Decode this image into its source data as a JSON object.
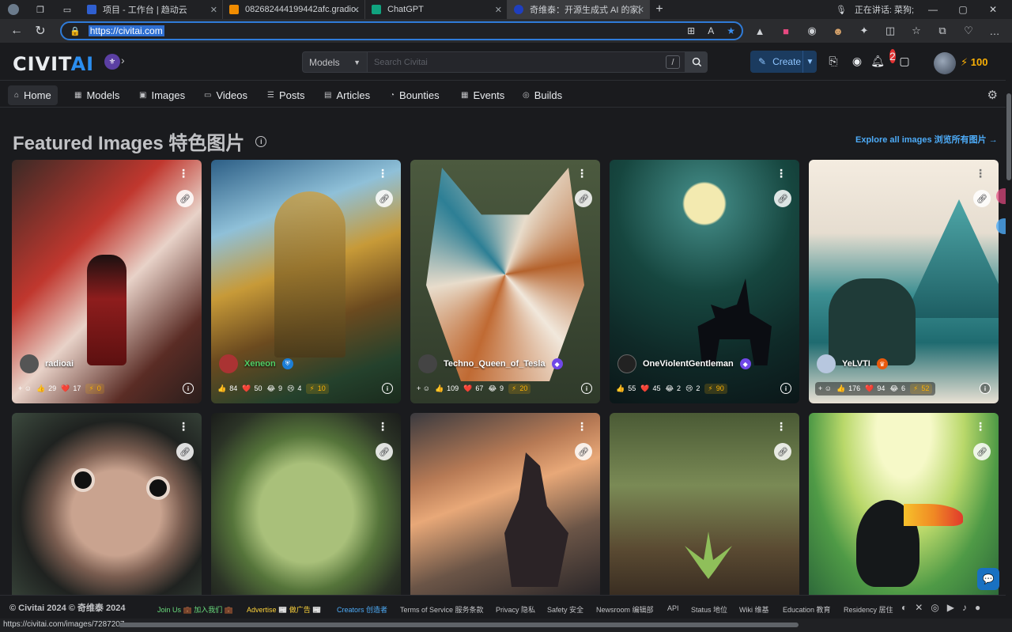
{
  "browser": {
    "tabs": [
      {
        "title": "项目 - 工作台 | 趋动云",
        "color": "#2f5fd0"
      },
      {
        "title": "082682444199442afc.gradio.live",
        "color": "#f08c00"
      },
      {
        "title": "ChatGPT",
        "color": "#10a37f"
      },
      {
        "title": "奇维泰：开源生成式 AI 的家园 -",
        "color": "#1f3fbf"
      }
    ],
    "speaking_text": "正在讲话: 菜狗;",
    "url": "https://civitai.com",
    "status_url": "https://civitai.com/images/7287207"
  },
  "header": {
    "logo_text": "CIVIT",
    "logo_ai": "AI",
    "search_scope": "Models",
    "search_placeholder": "Search Civitai",
    "search_shortcut": "/",
    "create_label": "Create",
    "notification_count": "2",
    "buzz_amount": "100"
  },
  "nav": {
    "items": [
      {
        "label": "Home",
        "icon": "home-icon",
        "glyph": "⌂"
      },
      {
        "label": "Models",
        "icon": "grid-icon",
        "glyph": "▦"
      },
      {
        "label": "Images",
        "icon": "image-icon",
        "glyph": "▣"
      },
      {
        "label": "Videos",
        "icon": "video-icon",
        "glyph": "▭"
      },
      {
        "label": "Posts",
        "icon": "posts-icon",
        "glyph": "☰"
      },
      {
        "label": "Articles",
        "icon": "article-icon",
        "glyph": "▤"
      },
      {
        "label": "Bounties",
        "icon": "bounty-icon",
        "glyph": "◔"
      },
      {
        "label": "Events",
        "icon": "calendar-icon",
        "glyph": "▦"
      },
      {
        "label": "Builds",
        "icon": "builds-icon",
        "glyph": "◎"
      }
    ]
  },
  "featured": {
    "title": "Featured Images 特色图片",
    "explore_label": "Explore all images 浏览所有图片",
    "cards": [
      {
        "user": "radioai",
        "likes": "29",
        "hearts": "17",
        "buzz": "0",
        "show_add": true,
        "laugh": "",
        "cry": ""
      },
      {
        "user": "Xeneon",
        "likes": "84",
        "hearts": "50",
        "laugh": "9",
        "cry": "4",
        "buzz": "10",
        "show_add": false
      },
      {
        "user": "Techno_Queen_of_Tesla",
        "likes": "109",
        "hearts": "67",
        "laugh": "9",
        "buzz": "20",
        "show_add": true,
        "cry": ""
      },
      {
        "user": "OneViolentGentleman",
        "likes": "55",
        "hearts": "45",
        "laugh": "2",
        "cry": "2",
        "buzz": "90",
        "show_add": false
      },
      {
        "user": "YeLVTI",
        "likes": "176",
        "hearts": "94",
        "laugh": "6",
        "buzz": "52",
        "show_add": true,
        "cry": ""
      }
    ]
  },
  "footer": {
    "copyright": "© Civitai 2024 © 奇维泰 2024",
    "join": "Join Us 💼 加入我们 💼",
    "advertise": "Advertise 📰 做广告 📰",
    "creators": "Creators 创造者",
    "terms": "Terms of Service 服务条款",
    "privacy": "Privacy 隐私",
    "safety": "Safety 安全",
    "newsroom": "Newsroom 编辑部",
    "api": "API",
    "status": "Status 地位",
    "wiki": "Wiki 维基",
    "education": "Education 教育",
    "residency": "Residency 居住"
  },
  "colors": {
    "accent": "#228be6",
    "buzz": "#fab005",
    "bg": "#1a1b1e"
  }
}
